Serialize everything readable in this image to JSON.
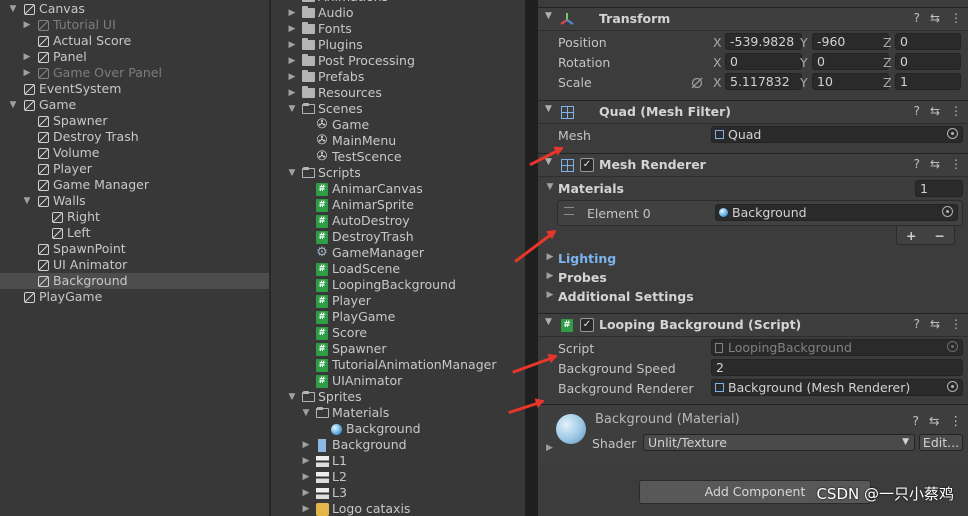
{
  "hierarchy": [
    {
      "label": "Canvas",
      "depth": 0,
      "fold": "open",
      "icon": "cube"
    },
    {
      "label": "Tutorial UI",
      "depth": 1,
      "fold": "closed",
      "icon": "cube",
      "dim": true
    },
    {
      "label": "Actual Score",
      "depth": 1,
      "fold": "",
      "icon": "cube"
    },
    {
      "label": "Panel",
      "depth": 1,
      "fold": "closed",
      "icon": "cube"
    },
    {
      "label": "Game Over Panel",
      "depth": 1,
      "fold": "closed",
      "icon": "cube",
      "dim": true
    },
    {
      "label": "EventSystem",
      "depth": 0,
      "fold": "",
      "icon": "cube"
    },
    {
      "label": "Game",
      "depth": 0,
      "fold": "open",
      "icon": "cube"
    },
    {
      "label": "Spawner",
      "depth": 1,
      "fold": "",
      "icon": "cube"
    },
    {
      "label": "Destroy Trash",
      "depth": 1,
      "fold": "",
      "icon": "cube"
    },
    {
      "label": "Volume",
      "depth": 1,
      "fold": "",
      "icon": "cube"
    },
    {
      "label": "Player",
      "depth": 1,
      "fold": "",
      "icon": "cube"
    },
    {
      "label": "Game Manager",
      "depth": 1,
      "fold": "",
      "icon": "cube"
    },
    {
      "label": "Walls",
      "depth": 1,
      "fold": "open",
      "icon": "cube"
    },
    {
      "label": "Right",
      "depth": 2,
      "fold": "",
      "icon": "cube"
    },
    {
      "label": "Left",
      "depth": 2,
      "fold": "",
      "icon": "cube"
    },
    {
      "label": "SpawnPoint",
      "depth": 1,
      "fold": "",
      "icon": "cube"
    },
    {
      "label": "UI Animator",
      "depth": 1,
      "fold": "",
      "icon": "cube"
    },
    {
      "label": "Background",
      "depth": 1,
      "fold": "",
      "icon": "cube",
      "selected": true
    },
    {
      "label": "PlayGame",
      "depth": 0,
      "fold": "",
      "icon": "cube"
    }
  ],
  "project": [
    {
      "label": "Animations",
      "depth": 0,
      "fold": "closed",
      "icon": "folder"
    },
    {
      "label": "Audio",
      "depth": 0,
      "fold": "closed",
      "icon": "folder"
    },
    {
      "label": "Fonts",
      "depth": 0,
      "fold": "closed",
      "icon": "folder"
    },
    {
      "label": "Plugins",
      "depth": 0,
      "fold": "closed",
      "icon": "folder"
    },
    {
      "label": "Post Processing",
      "depth": 0,
      "fold": "closed",
      "icon": "folder"
    },
    {
      "label": "Prefabs",
      "depth": 0,
      "fold": "closed",
      "icon": "folder"
    },
    {
      "label": "Resources",
      "depth": 0,
      "fold": "closed",
      "icon": "folder"
    },
    {
      "label": "Scenes",
      "depth": 0,
      "fold": "open",
      "icon": "folder-open"
    },
    {
      "label": "Game",
      "depth": 1,
      "fold": "",
      "icon": "scene"
    },
    {
      "label": "MainMenu",
      "depth": 1,
      "fold": "",
      "icon": "scene"
    },
    {
      "label": "TestScence",
      "depth": 1,
      "fold": "",
      "icon": "scene"
    },
    {
      "label": "Scripts",
      "depth": 0,
      "fold": "open",
      "icon": "folder-open"
    },
    {
      "label": "AnimarCanvas",
      "depth": 1,
      "fold": "",
      "icon": "script"
    },
    {
      "label": "AnimarSprite",
      "depth": 1,
      "fold": "",
      "icon": "script"
    },
    {
      "label": "AutoDestroy",
      "depth": 1,
      "fold": "",
      "icon": "script"
    },
    {
      "label": "DestroyTrash",
      "depth": 1,
      "fold": "",
      "icon": "script"
    },
    {
      "label": "GameManager",
      "depth": 1,
      "fold": "",
      "icon": "gear"
    },
    {
      "label": "LoadScene",
      "depth": 1,
      "fold": "",
      "icon": "script"
    },
    {
      "label": "LoopingBackground",
      "depth": 1,
      "fold": "",
      "icon": "script"
    },
    {
      "label": "Player",
      "depth": 1,
      "fold": "",
      "icon": "script"
    },
    {
      "label": "PlayGame",
      "depth": 1,
      "fold": "",
      "icon": "script"
    },
    {
      "label": "Score",
      "depth": 1,
      "fold": "",
      "icon": "script"
    },
    {
      "label": "Spawner",
      "depth": 1,
      "fold": "",
      "icon": "script"
    },
    {
      "label": "TutorialAnimationManager",
      "depth": 1,
      "fold": "",
      "icon": "script"
    },
    {
      "label": "UIAnimator",
      "depth": 1,
      "fold": "",
      "icon": "script"
    },
    {
      "label": "Sprites",
      "depth": 0,
      "fold": "open",
      "icon": "folder-open"
    },
    {
      "label": "Materials",
      "depth": 1,
      "fold": "open",
      "icon": "folder-open"
    },
    {
      "label": "Background",
      "depth": 2,
      "fold": "",
      "icon": "material"
    },
    {
      "label": "Background",
      "depth": 1,
      "fold": "closed",
      "icon": "sprite"
    },
    {
      "label": "L1",
      "depth": 1,
      "fold": "closed",
      "icon": "texture"
    },
    {
      "label": "L2",
      "depth": 1,
      "fold": "closed",
      "icon": "texture"
    },
    {
      "label": "L3",
      "depth": 1,
      "fold": "closed",
      "icon": "texture"
    },
    {
      "label": "Logo cataxis",
      "depth": 1,
      "fold": "closed",
      "icon": "logo"
    }
  ],
  "inspector": {
    "transform": {
      "title": "Transform",
      "position": {
        "label": "Position",
        "x": "-539.9828",
        "y": "-960",
        "z": "0"
      },
      "rotation": {
        "label": "Rotation",
        "x": "0",
        "y": "0",
        "z": "0"
      },
      "scale": {
        "label": "Scale",
        "x": "5.117832",
        "y": "10",
        "z": "1"
      },
      "axis": {
        "x": "X",
        "y": "Y",
        "z": "Z"
      }
    },
    "mesh_filter": {
      "title": "Quad (Mesh Filter)",
      "mesh_label": "Mesh",
      "mesh_value": "Quad"
    },
    "mesh_renderer": {
      "title": "Mesh Renderer",
      "materials_label": "Materials",
      "materials_count": "1",
      "element_label": "Element 0",
      "element_value": "Background",
      "plus": "+",
      "minus": "−",
      "lighting": "Lighting",
      "probes": "Probes",
      "additional": "Additional Settings"
    },
    "looping": {
      "title": "Looping Background (Script)",
      "script_label": "Script",
      "script_value": "LoopingBackground",
      "speed_label": "Background Speed",
      "speed_value": "2",
      "renderer_label": "Background Renderer",
      "renderer_value": "Background (Mesh Renderer)"
    },
    "material": {
      "title": "Background (Material)",
      "shader_label": "Shader",
      "shader_value": "Unlit/Texture",
      "edit": "Edit..."
    },
    "add_component": "Add Component",
    "watermark": "CSDN @一只小蔡鸡",
    "header_icons": {
      "help": "?",
      "preset": "⇆",
      "menu": "⋮"
    }
  },
  "colors": {
    "arrow": "#e8362a",
    "selected": "#4d4d4d",
    "script_green": "#2f9d46",
    "lighting_blue": "#7cb4f0"
  }
}
